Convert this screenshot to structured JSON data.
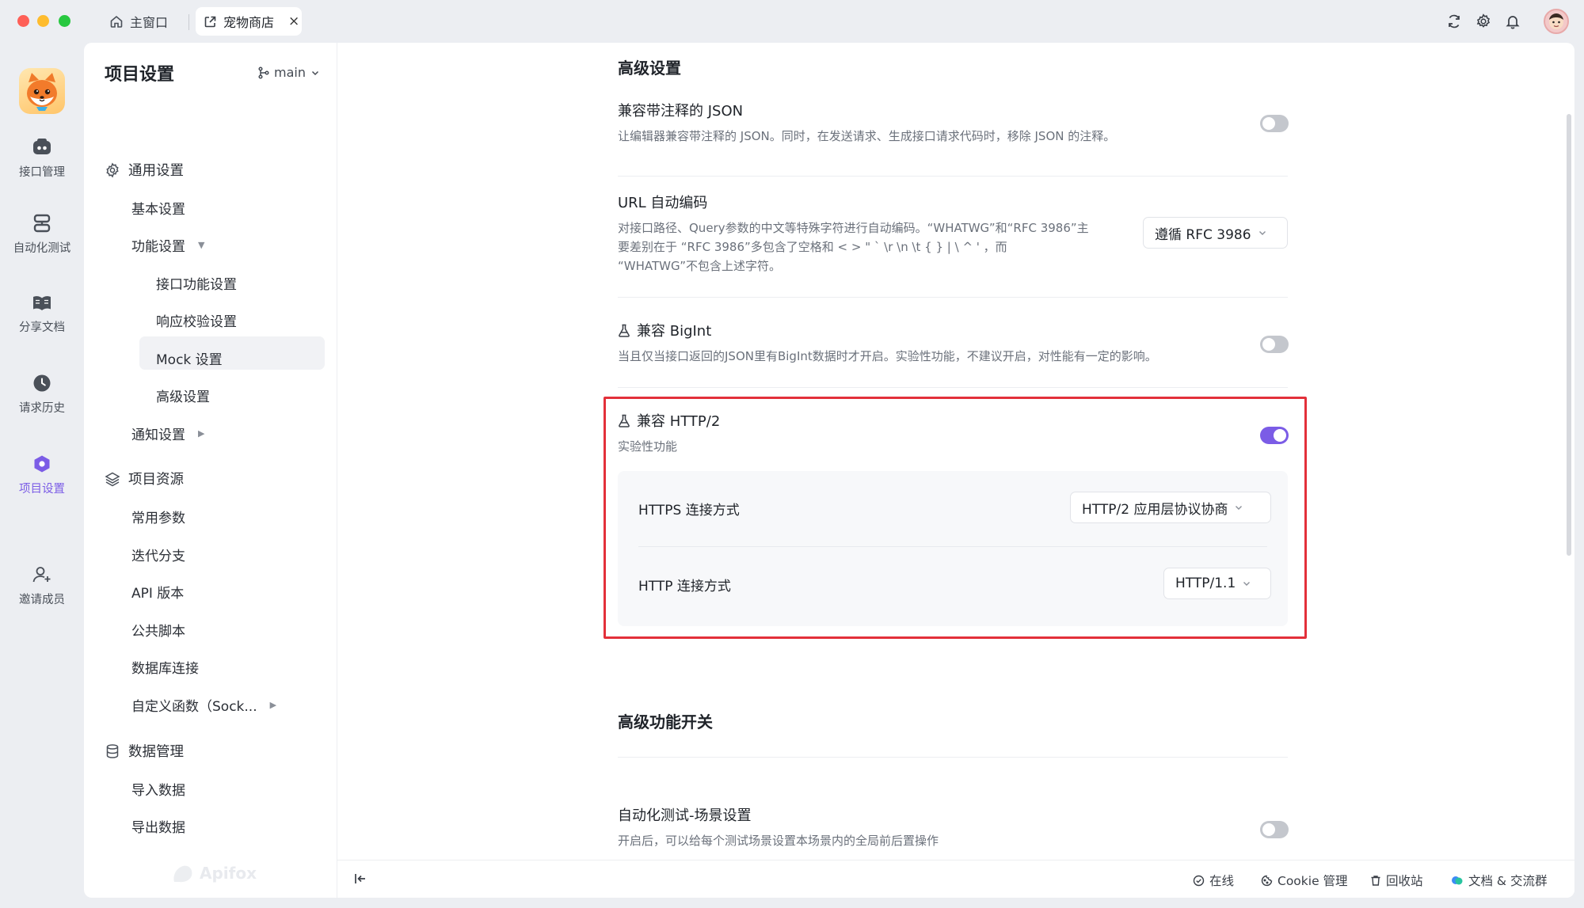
{
  "titlebar": {
    "tabs": [
      {
        "label": "主窗口",
        "icon": "home-icon"
      },
      {
        "label": "宠物商店",
        "icon": "external-link-icon"
      }
    ],
    "close_glyph": "×",
    "right_icons": [
      "refresh-icon",
      "gear-icon",
      "bell-icon",
      "avatar"
    ]
  },
  "rail": {
    "items": [
      {
        "label": "接口管理",
        "icon": "api-icon"
      },
      {
        "label": "自动化测试",
        "icon": "automation-icon"
      },
      {
        "label": "分享文档",
        "icon": "book-icon"
      },
      {
        "label": "请求历史",
        "icon": "clock-icon"
      },
      {
        "label": "项目设置",
        "icon": "hexagon-icon",
        "active": true
      },
      {
        "label": "邀请成员",
        "icon": "user-plus-icon"
      }
    ]
  },
  "nav": {
    "title": "项目设置",
    "branch": "main",
    "groups": {
      "general": {
        "label": "通用设置",
        "items": [
          "基本设置",
          "功能设置",
          "接口功能设置",
          "响应校验设置",
          "Mock 设置",
          "高级设置",
          "通知设置"
        ]
      },
      "resources": {
        "label": "项目资源",
        "items": [
          "常用参数",
          "迭代分支",
          "API 版本",
          "公共脚本",
          "数据库连接",
          "自定义函数（Sock..."
        ]
      },
      "data": {
        "label": "数据管理",
        "items": [
          "导入数据",
          "导出数据"
        ]
      }
    },
    "watermark": "Apifox"
  },
  "content": {
    "advanced_title": "高级设置",
    "json_comments": {
      "title": "兼容带注释的 JSON",
      "desc": "让编辑器兼容带注释的 JSON。同时，在发送请求、生成接口请求代码时，移除 JSON 的注释。",
      "enabled": false
    },
    "url_encoding": {
      "title": "URL 自动编码",
      "desc_line1": "对接口路径、Query参数的中文等特殊字符进行自动编码。“WHATWG”和“RFC 3986”主",
      "desc_line2": "要差别在于 “RFC 3986”多包含了空格和 < > \" ` \\r \\n \\t { } | \\ ^ ' ，而",
      "desc_line3": "“WHATWG”不包含上述字符。",
      "selected": "遵循 RFC 3986"
    },
    "bigint": {
      "title": "兼容 BigInt",
      "desc": "当且仅当接口返回的JSON里有BigInt数据时才开启。实验性功能，不建议开启，对性能有一定的影响。",
      "enabled": false
    },
    "http2": {
      "title": "兼容 HTTP/2",
      "desc": "实验性功能",
      "enabled": true,
      "https_label": "HTTPS 连接方式",
      "https_value": "HTTP/2 应用层协议协商",
      "http_label": "HTTP 连接方式",
      "http_value": "HTTP/1.1"
    },
    "advanced_switches_title": "高级功能开关",
    "scene_settings": {
      "title": "自动化测试-场景设置",
      "desc": "开启后，可以给每个测试场景设置本场景内的全局前后置操作",
      "enabled": false
    }
  },
  "footer": {
    "online": "在线",
    "cookie": "Cookie 管理",
    "recycle": "回收站",
    "docs": "文档 & 交流群"
  },
  "colors": {
    "accent": "#7b5ce6",
    "highlight_border": "#e3303a"
  }
}
